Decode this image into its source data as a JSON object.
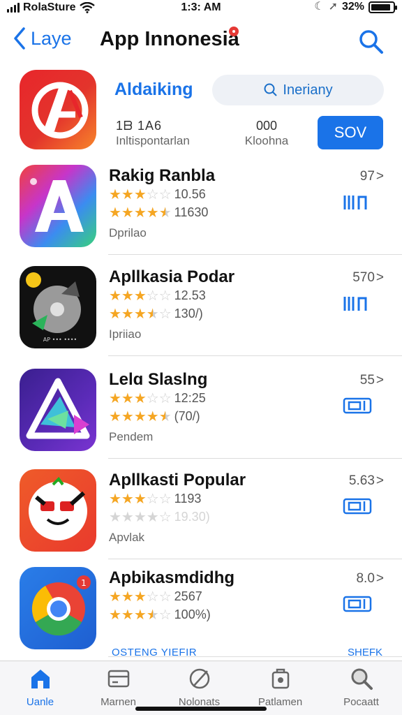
{
  "status_bar": {
    "carrier": "RolaSture",
    "time": "1:3: AM",
    "battery_pct": "32%",
    "battery_level": 0.9,
    "signal_icon": "signal-bars-icon",
    "wifi_icon": "wifi-icon",
    "moon_icon": "moon-icon",
    "location_icon": "location-arrow-icon"
  },
  "nav": {
    "back_label": "Laye",
    "title": "App Innonesia",
    "search_icon": "search-icon",
    "accent": "#1a73e8"
  },
  "featured": {
    "name": "Aldaiking",
    "search_pill": "Ineriany",
    "stat1_top": "1ᗷ  1A6",
    "stat1_bottom": "Inltispontarlan",
    "stat2_top": "000",
    "stat2_bottom": "Kloohna",
    "get_label": "SOV"
  },
  "apps": [
    {
      "name": "Rakig Ranbla",
      "rating1": "10.56",
      "rating2": "11630",
      "category": "Dprilao",
      "price": "97",
      "action_icon": "bars-arrow-icon",
      "stars1": 3,
      "stars2": 4.5,
      "faded2": false
    },
    {
      "name": "Apllkasia Podar",
      "rating1": "12.53",
      "rating2": "130/)",
      "category": "Ipriiao",
      "price": "570",
      "action_icon": "bars-arrow-icon",
      "stars1": 3,
      "stars2": 3.5,
      "faded2": false
    },
    {
      "name": "Lelɑ Slaslng",
      "rating1": "12:25",
      "rating2": "(70/)",
      "category": "Pendem",
      "price": "55",
      "action_icon": "box-icon",
      "stars1": 3,
      "stars2": 4.5,
      "faded2": false
    },
    {
      "name": "Apllkasti Popular",
      "rating1": "1193",
      "rating2": "19.30)",
      "category": "Apvlak",
      "price": "5.63",
      "action_icon": "box-icon",
      "stars1": 3,
      "stars2": 4,
      "faded2": true
    },
    {
      "name": "Apbikasmdidhg",
      "rating1": "2567",
      "rating2": "100%)",
      "category": "",
      "price": "8.0",
      "action_icon": "box-icon",
      "stars1": 3,
      "stars2": 3.5,
      "faded2": false
    }
  ],
  "peek": {
    "left": "OSTENG YIEFIR",
    "right": "SHEFK"
  },
  "tabs": [
    {
      "label": "Uanle",
      "icon": "home-icon",
      "active": true
    },
    {
      "label": "Marnen",
      "icon": "card-icon",
      "active": false
    },
    {
      "label": "Nolonats",
      "icon": "rocket-icon",
      "active": false
    },
    {
      "label": "Patlamen",
      "icon": "stack-icon",
      "active": false
    },
    {
      "label": "Pocaatt",
      "icon": "search-icon",
      "active": false
    }
  ]
}
